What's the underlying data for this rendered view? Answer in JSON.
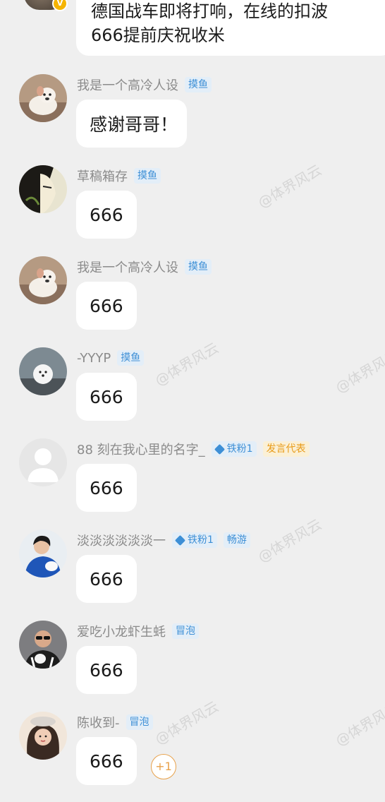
{
  "top_message": {
    "line1": "德国战车即将打响，在线的扣波",
    "line2": "666提前庆祝收米"
  },
  "messages": [
    {
      "name": "我是一个高冷人设",
      "badges": [
        {
          "type": "fish",
          "label": "摸鱼"
        }
      ],
      "text": "感谢哥哥！",
      "avatar": "dog-photo-icon"
    },
    {
      "name": "草稿箱存",
      "badges": [
        {
          "type": "fish",
          "label": "摸鱼"
        }
      ],
      "text": "666",
      "avatar": "anime-character-icon"
    },
    {
      "name": "我是一个高冷人设",
      "badges": [
        {
          "type": "fish",
          "label": "摸鱼"
        }
      ],
      "text": "666",
      "avatar": "dog-photo-icon"
    },
    {
      "name": "-YYYP",
      "badges": [
        {
          "type": "fish",
          "label": "摸鱼"
        }
      ],
      "text": "666",
      "avatar": "white-dog-icon"
    },
    {
      "name": "88 刻在我心里的名字_",
      "badges": [
        {
          "type": "tie",
          "label": "铁粉1"
        },
        {
          "type": "rep",
          "label": "发言代表"
        }
      ],
      "text": "666",
      "avatar": "default-person-icon"
    },
    {
      "name": "淡淡淡淡淡淡一",
      "badges": [
        {
          "type": "tie",
          "label": "铁粉1"
        },
        {
          "type": "fish",
          "label": "畅游"
        }
      ],
      "text": "666",
      "avatar": "blue-jacket-person-icon"
    },
    {
      "name": "爱吃小龙虾生蚝",
      "badges": [
        {
          "type": "fish",
          "label": "冒泡"
        }
      ],
      "text": "666",
      "avatar": "sunglasses-man-icon"
    },
    {
      "name": "陈收到-",
      "badges": [
        {
          "type": "fish",
          "label": "冒泡"
        }
      ],
      "text": "666",
      "avatar": "illustrated-girl-icon"
    }
  ],
  "reaction_count": "+1",
  "watermark_text": "@体界风云",
  "colors": {
    "background": "#efefef",
    "bubble": "#ffffff",
    "name": "#8b8b8b",
    "badge_blue": "#3d8fd6",
    "badge_orange": "#e89b18"
  }
}
